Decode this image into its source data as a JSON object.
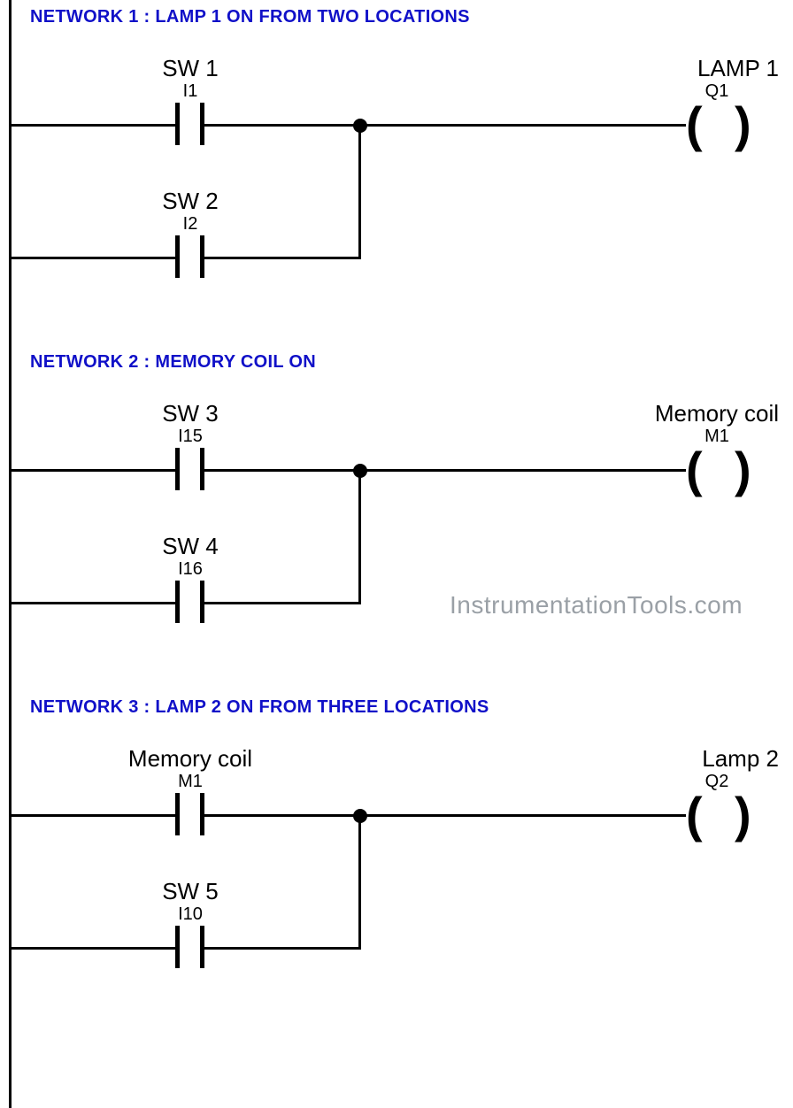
{
  "watermark": "InstrumentationTools.com",
  "networks": [
    {
      "title": "NETWORK 1 : LAMP 1 ON FROM TWO LOCATIONS",
      "contacts": [
        {
          "name": "SW 1",
          "addr": "I1"
        },
        {
          "name": "SW 2",
          "addr": "I2"
        }
      ],
      "coil": {
        "name": "LAMP 1",
        "addr": "Q1"
      }
    },
    {
      "title": "NETWORK 2 : MEMORY COIL ON",
      "contacts": [
        {
          "name": "SW 3",
          "addr": "I15"
        },
        {
          "name": "SW 4",
          "addr": "I16"
        }
      ],
      "coil": {
        "name": "Memory coil",
        "addr": "M1"
      }
    },
    {
      "title": "NETWORK 3 : LAMP 2 ON FROM THREE LOCATIONS",
      "contacts": [
        {
          "name": "Memory coil",
          "addr": "M1"
        },
        {
          "name": "SW 5",
          "addr": "I10"
        }
      ],
      "coil": {
        "name": "Lamp 2",
        "addr": "Q2"
      }
    }
  ]
}
